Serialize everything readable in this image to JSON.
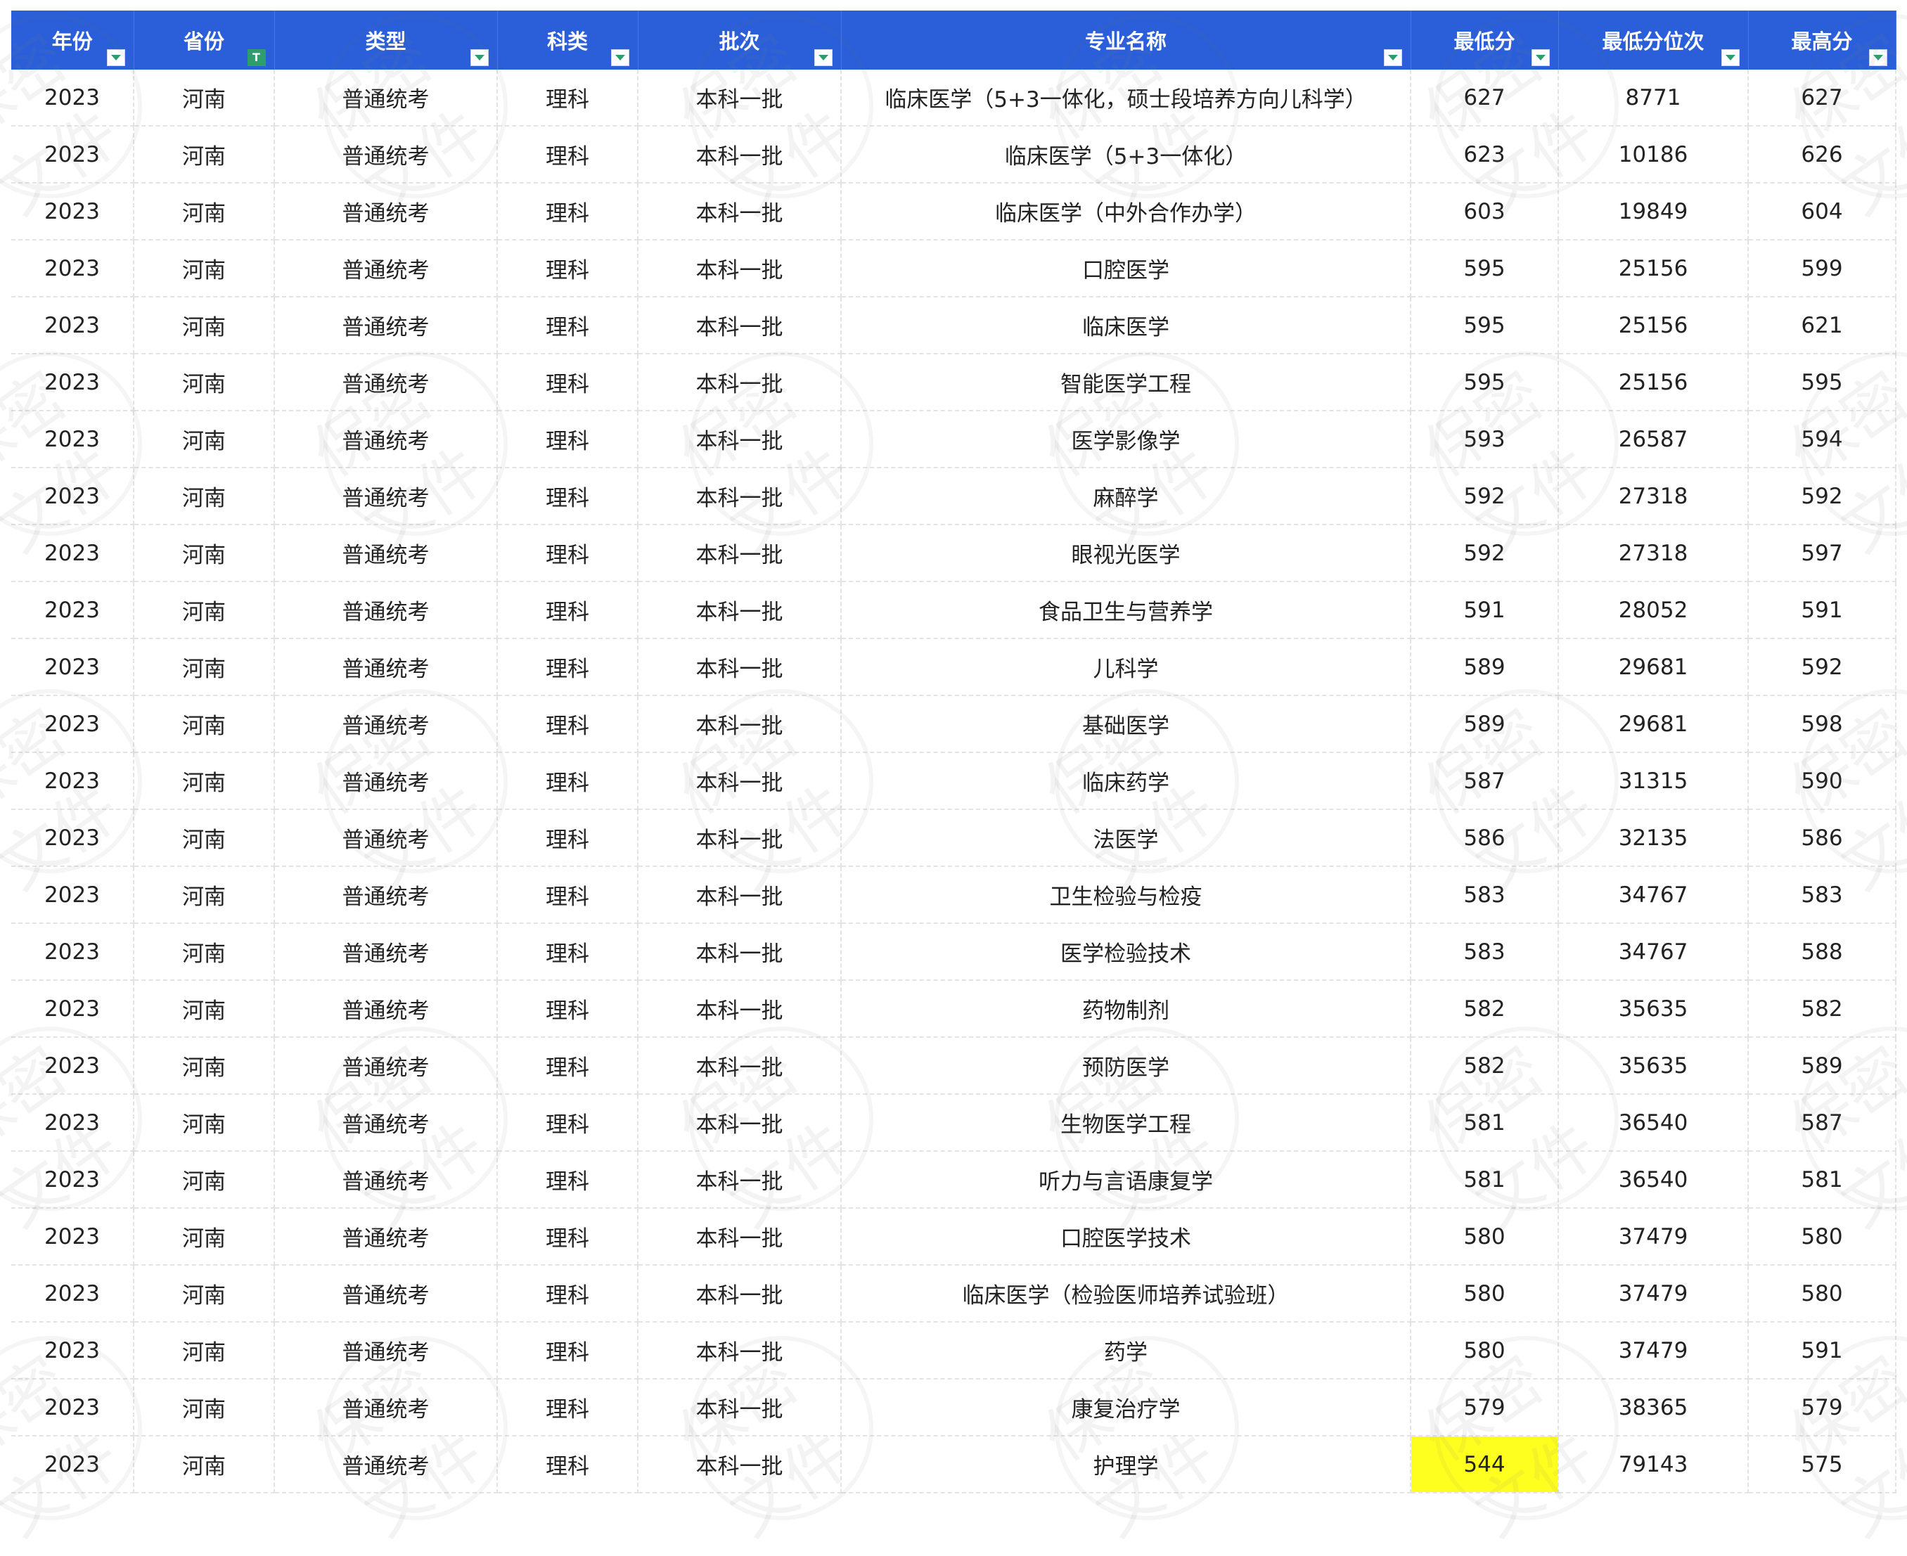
{
  "colors": {
    "header_bg": "#2b5fd9",
    "header_text": "#ffffff",
    "filter_icon": "#2f9e6e",
    "highlight": "#ffff1f"
  },
  "watermark_text": "保密文件",
  "columns": [
    {
      "label": "年份",
      "filter_icon": "filter-dropdown-icon"
    },
    {
      "label": "省份",
      "filter_icon": "filter-active-icon"
    },
    {
      "label": "类型",
      "filter_icon": "filter-dropdown-icon"
    },
    {
      "label": "科类",
      "filter_icon": "filter-dropdown-icon"
    },
    {
      "label": "批次",
      "filter_icon": "filter-dropdown-icon"
    },
    {
      "label": "专业名称",
      "filter_icon": "filter-dropdown-icon"
    },
    {
      "label": "最低分",
      "filter_icon": "filter-dropdown-icon"
    },
    {
      "label": "最低分位次",
      "filter_icon": "filter-dropdown-icon"
    },
    {
      "label": "最高分",
      "filter_icon": "filter-dropdown-icon"
    }
  ],
  "rows": [
    [
      "2023",
      "河南",
      "普通统考",
      "理科",
      "本科一批",
      "临床医学（5+3一体化，硕士段培养方向儿科学）",
      "627",
      "8771",
      "627"
    ],
    [
      "2023",
      "河南",
      "普通统考",
      "理科",
      "本科一批",
      "临床医学（5+3一体化）",
      "623",
      "10186",
      "626"
    ],
    [
      "2023",
      "河南",
      "普通统考",
      "理科",
      "本科一批",
      "临床医学（中外合作办学）",
      "603",
      "19849",
      "604"
    ],
    [
      "2023",
      "河南",
      "普通统考",
      "理科",
      "本科一批",
      "口腔医学",
      "595",
      "25156",
      "599"
    ],
    [
      "2023",
      "河南",
      "普通统考",
      "理科",
      "本科一批",
      "临床医学",
      "595",
      "25156",
      "621"
    ],
    [
      "2023",
      "河南",
      "普通统考",
      "理科",
      "本科一批",
      "智能医学工程",
      "595",
      "25156",
      "595"
    ],
    [
      "2023",
      "河南",
      "普通统考",
      "理科",
      "本科一批",
      "医学影像学",
      "593",
      "26587",
      "594"
    ],
    [
      "2023",
      "河南",
      "普通统考",
      "理科",
      "本科一批",
      "麻醉学",
      "592",
      "27318",
      "592"
    ],
    [
      "2023",
      "河南",
      "普通统考",
      "理科",
      "本科一批",
      "眼视光医学",
      "592",
      "27318",
      "597"
    ],
    [
      "2023",
      "河南",
      "普通统考",
      "理科",
      "本科一批",
      "食品卫生与营养学",
      "591",
      "28052",
      "591"
    ],
    [
      "2023",
      "河南",
      "普通统考",
      "理科",
      "本科一批",
      "儿科学",
      "589",
      "29681",
      "592"
    ],
    [
      "2023",
      "河南",
      "普通统考",
      "理科",
      "本科一批",
      "基础医学",
      "589",
      "29681",
      "598"
    ],
    [
      "2023",
      "河南",
      "普通统考",
      "理科",
      "本科一批",
      "临床药学",
      "587",
      "31315",
      "590"
    ],
    [
      "2023",
      "河南",
      "普通统考",
      "理科",
      "本科一批",
      "法医学",
      "586",
      "32135",
      "586"
    ],
    [
      "2023",
      "河南",
      "普通统考",
      "理科",
      "本科一批",
      "卫生检验与检疫",
      "583",
      "34767",
      "583"
    ],
    [
      "2023",
      "河南",
      "普通统考",
      "理科",
      "本科一批",
      "医学检验技术",
      "583",
      "34767",
      "588"
    ],
    [
      "2023",
      "河南",
      "普通统考",
      "理科",
      "本科一批",
      "药物制剂",
      "582",
      "35635",
      "582"
    ],
    [
      "2023",
      "河南",
      "普通统考",
      "理科",
      "本科一批",
      "预防医学",
      "582",
      "35635",
      "589"
    ],
    [
      "2023",
      "河南",
      "普通统考",
      "理科",
      "本科一批",
      "生物医学工程",
      "581",
      "36540",
      "587"
    ],
    [
      "2023",
      "河南",
      "普通统考",
      "理科",
      "本科一批",
      "听力与言语康复学",
      "581",
      "36540",
      "581"
    ],
    [
      "2023",
      "河南",
      "普通统考",
      "理科",
      "本科一批",
      "口腔医学技术",
      "580",
      "37479",
      "580"
    ],
    [
      "2023",
      "河南",
      "普通统考",
      "理科",
      "本科一批",
      "临床医学（检验医师培养试验班）",
      "580",
      "37479",
      "580"
    ],
    [
      "2023",
      "河南",
      "普通统考",
      "理科",
      "本科一批",
      "药学",
      "580",
      "37479",
      "591"
    ],
    [
      "2023",
      "河南",
      "普通统考",
      "理科",
      "本科一批",
      "康复治疗学",
      "579",
      "38365",
      "579"
    ],
    [
      "2023",
      "河南",
      "普通统考",
      "理科",
      "本科一批",
      "护理学",
      "544",
      "79143",
      "575"
    ]
  ],
  "highlighted_cell": {
    "row": 24,
    "column": 6
  }
}
